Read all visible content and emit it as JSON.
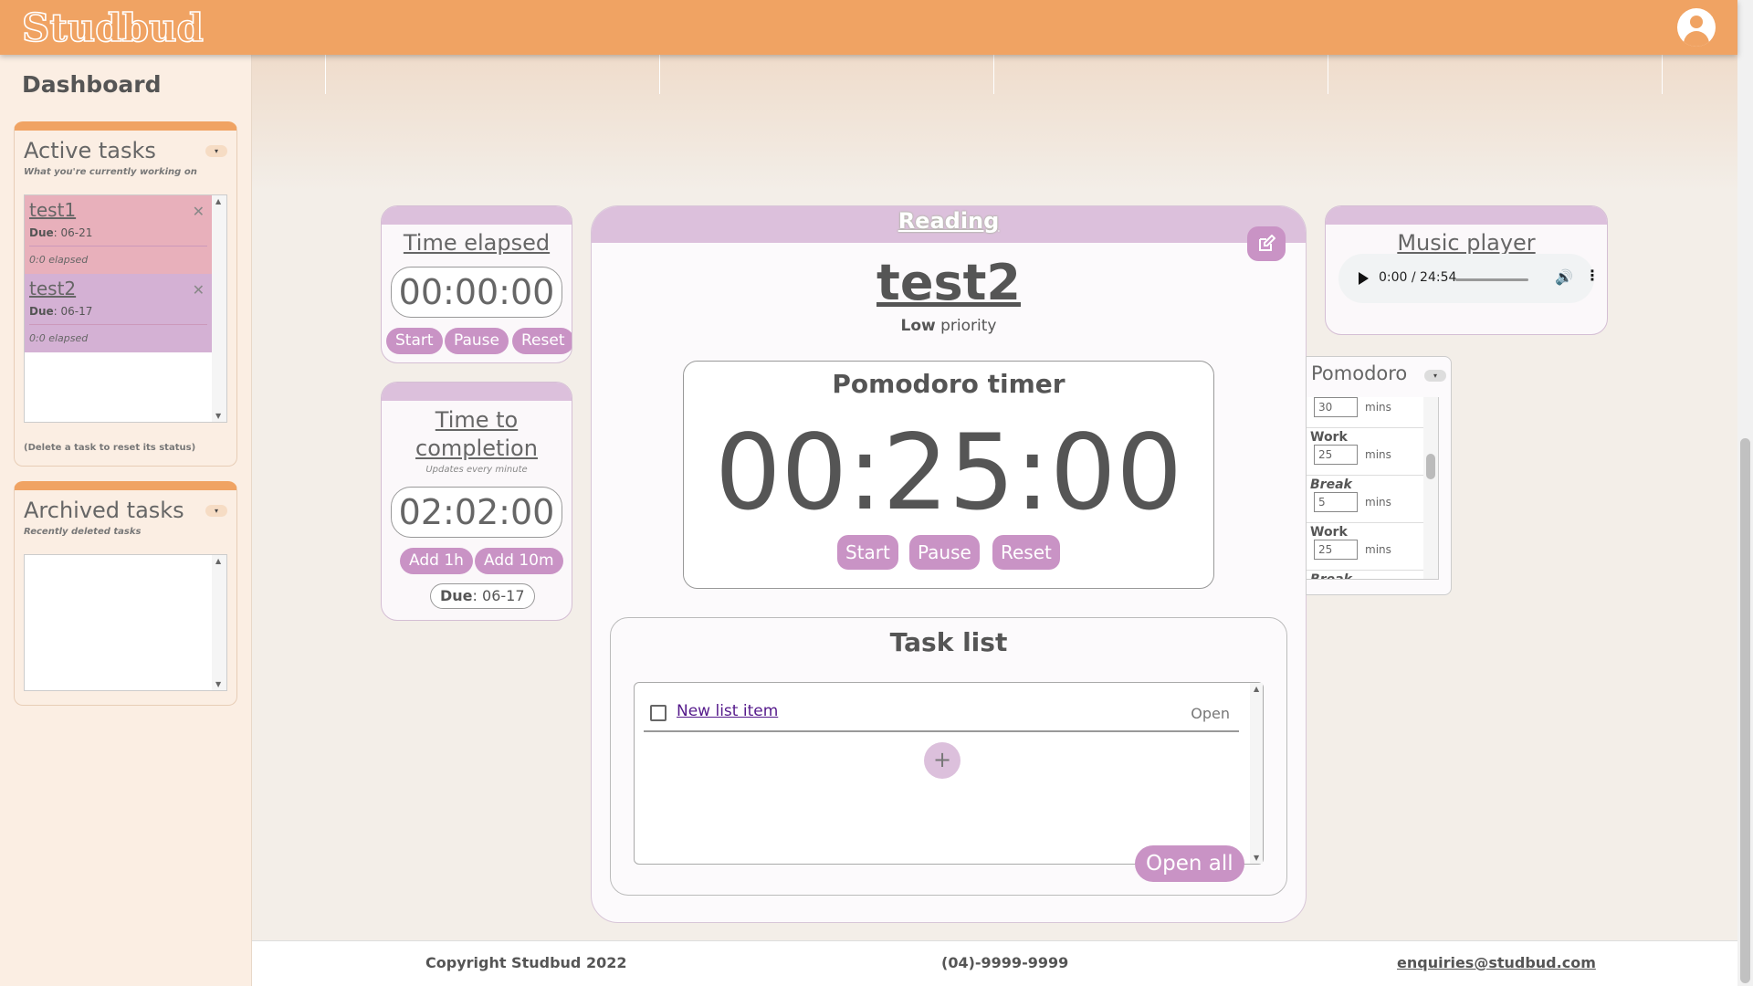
{
  "header": {
    "logo": "Studbud",
    "avatar_icon": "user-avatar-icon",
    "accent_color": "#f0a363"
  },
  "sidebar": {
    "title": "Dashboard",
    "active_tasks": {
      "title": "Active tasks",
      "subtitle": "What you're currently working on",
      "collapse_icon": "▾",
      "tasks": [
        {
          "name": "test1",
          "due_label": "Due",
          "due": ": 06-21",
          "elapsed": "0:0 elapsed",
          "color": "#e8b0bb"
        },
        {
          "name": "test2",
          "due_label": "Due",
          "due": ": 06-17",
          "elapsed": "0:0 elapsed",
          "color": "#d4b1d4"
        }
      ],
      "note": "(Delete a task to reset its status)"
    },
    "archived_tasks": {
      "title": "Archived tasks",
      "subtitle": "Recently deleted tasks",
      "collapse_icon": "▾"
    }
  },
  "time_elapsed": {
    "title": "Time elapsed",
    "value": "00:00:00",
    "buttons": {
      "start": "Start",
      "pause": "Pause",
      "reset": "Reset"
    }
  },
  "time_to_completion": {
    "title": "Time to completion",
    "subtitle": "Updates every minute",
    "value": "02:02:00",
    "buttons": {
      "add_hour": "Add 1h",
      "add_ten": "Add 10m"
    },
    "due_label": "Due",
    "due_value": ": 06-17"
  },
  "focus": {
    "category": "Reading",
    "task_name": "test2",
    "priority_level": "Low",
    "priority_word": "priority",
    "pomodoro": {
      "title": "Pomodoro timer",
      "time": "00:25:00",
      "buttons": {
        "start": "Start",
        "pause": "Pause",
        "reset": "Reset"
      }
    },
    "task_list": {
      "title": "Task list",
      "items": [
        {
          "label": "New list item",
          "status": "Open"
        }
      ],
      "add_symbol": "+",
      "open_all": "Open all"
    }
  },
  "music_player": {
    "title": "Music player",
    "time": "0:00 / 24:54"
  },
  "pomodoro_settings": {
    "title": "Pomodoro",
    "collapse_icon": "▾",
    "rows": [
      {
        "label": "",
        "italic": false,
        "value": "30",
        "unit": "mins"
      },
      {
        "label": "Work",
        "italic": false,
        "value": "25",
        "unit": "mins"
      },
      {
        "label": "Break",
        "italic": true,
        "value": "5",
        "unit": "mins"
      },
      {
        "label": "Work",
        "italic": false,
        "value": "25",
        "unit": "mins"
      },
      {
        "label": "Break",
        "italic": true,
        "value": "",
        "unit": ""
      }
    ]
  },
  "footer": {
    "copyright": "Copyright Studbud 2022",
    "phone": "(04)-9999-9999",
    "email": "enquiries@studbud.com"
  }
}
